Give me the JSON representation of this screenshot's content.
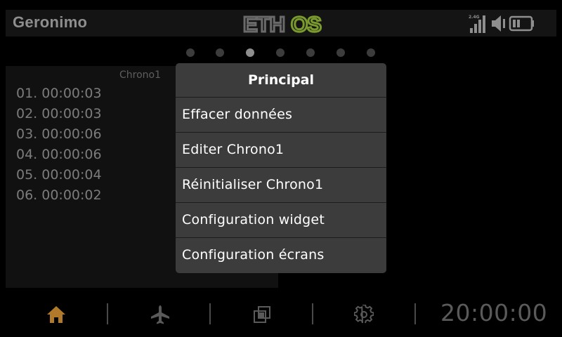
{
  "header": {
    "model_name": "Geronimo",
    "logo_text_a": "ETH",
    "logo_text_b": "OS",
    "rf_band": "2.4G",
    "colors": {
      "logo_a": "#6a6a6a",
      "logo_b": "#7a9a2e"
    }
  },
  "pager": {
    "count": 7,
    "active_index": 2
  },
  "widget": {
    "title": "Chrono1",
    "laps": [
      "01. 00:00:03",
      "02. 00:00:03",
      "03. 00:00:06",
      "04. 00:00:06",
      "05. 00:00:04",
      "06. 00:00:02"
    ]
  },
  "menu": {
    "title": "Principal",
    "items": [
      "Effacer données",
      "Editer Chrono1",
      "Réinitialiser Chrono1",
      "Configuration widget",
      "Configuration écrans"
    ]
  },
  "footer": {
    "icons": [
      "home-icon",
      "airplane-icon",
      "screens-icon",
      "gear-icon"
    ],
    "clock": "20:00:00",
    "colors": {
      "home_active": "#b07a2a",
      "inactive": "#5a5a5a"
    }
  }
}
